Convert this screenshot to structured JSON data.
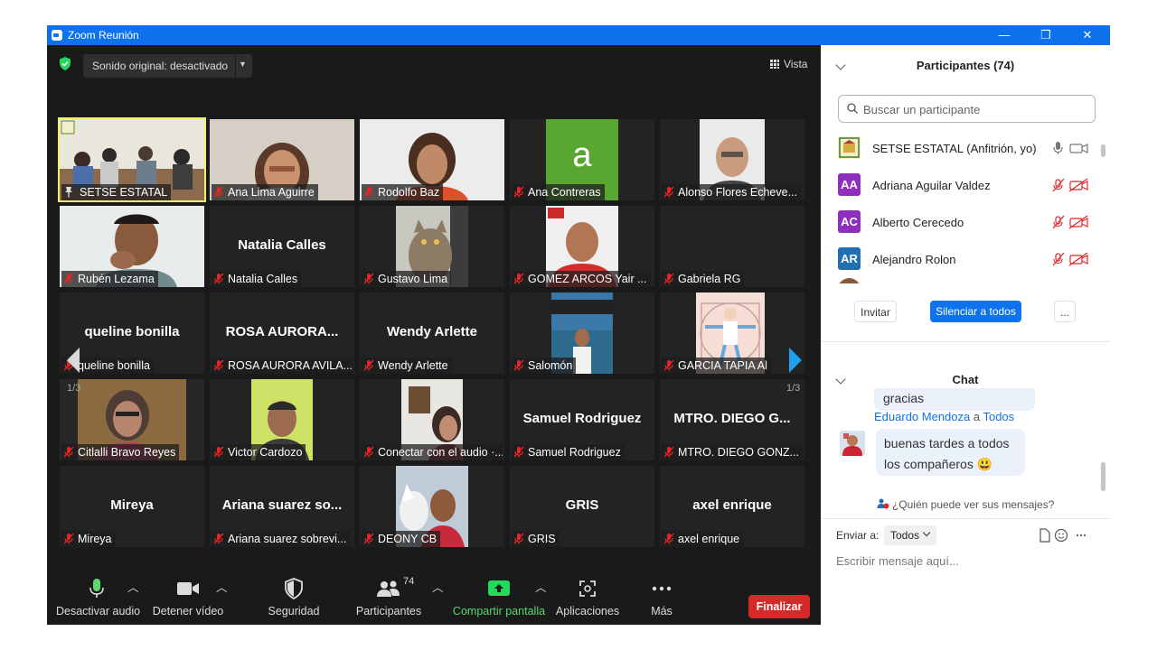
{
  "window": {
    "title": "Zoom Reunión",
    "minimize": "—",
    "restore": "❐",
    "close": "✕"
  },
  "meeting_top": {
    "sonido_label": "Sonido original: desactivado",
    "vista_label": "Vista"
  },
  "pages": {
    "left": "1/3",
    "right": "1/3"
  },
  "tiles": [
    {
      "name": "SETSE ESTATAL",
      "big": "",
      "active": true,
      "pinned": true,
      "video": "room"
    },
    {
      "name": "Ana Lima Aguirre",
      "big": "",
      "video": "woman1"
    },
    {
      "name": "Rodolfo Baz",
      "big": "",
      "video": "woman2"
    },
    {
      "name": "Ana Contreras",
      "big": "",
      "video": "letter"
    },
    {
      "name": "Alonso Flores Echeve...",
      "big": "",
      "video": "man1"
    },
    {
      "name": "Rubén Lezama",
      "big": "",
      "video": "man2"
    },
    {
      "name": "Natalia Calles",
      "big": "Natalia Calles",
      "video": ""
    },
    {
      "name": "Gustavo Lima",
      "big": "",
      "video": "cat"
    },
    {
      "name": "GOMEZ ARCOS Yair ...",
      "big": "",
      "video": "man3"
    },
    {
      "name": "Gabriela RG",
      "big": "",
      "video": ""
    },
    {
      "name": "queline bonilla",
      "big": "queline bonilla",
      "video": ""
    },
    {
      "name": "ROSA AURORA AVILA...",
      "big": "ROSA  AURORA...",
      "video": ""
    },
    {
      "name": "Wendy  Arlette",
      "big": "Wendy  Arlette",
      "video": ""
    },
    {
      "name": "Salomón",
      "big": "",
      "video": "man4"
    },
    {
      "name": "GARCIA TAPIA Al",
      "big": "",
      "video": "drawing"
    },
    {
      "name": "Citlalli Bravo Reyes",
      "big": "",
      "video": "woman3"
    },
    {
      "name": "Victor Cardozo",
      "big": "",
      "video": "man5"
    },
    {
      "name": "Conectar con el audio ·...",
      "big": "",
      "video": "woman4"
    },
    {
      "name": "Samuel Rodriguez",
      "big": "Samuel Rodriguez",
      "video": ""
    },
    {
      "name": "MTRO. DIEGO GONZ...",
      "big": "MTRO. DIEGO G...",
      "video": ""
    },
    {
      "name": "Mireya",
      "big": "Mireya",
      "video": ""
    },
    {
      "name": "Ariana suarez sobrevi...",
      "big": "Ariana suarez so...",
      "video": ""
    },
    {
      "name": "DEONY CB",
      "big": "",
      "video": "man6"
    },
    {
      "name": "GRIS",
      "big": "GRIS",
      "video": ""
    },
    {
      "name": "axel enrique",
      "big": "axel enrique",
      "video": ""
    }
  ],
  "toolbar": {
    "audio": "Desactivar audio",
    "video": "Detener vídeo",
    "security": "Seguridad",
    "participants": "Participantes",
    "participants_count": "74",
    "share": "Compartir pantalla",
    "apps": "Aplicaciones",
    "more": "Más",
    "end": "Finalizar"
  },
  "participants_panel": {
    "title": "Participantes (74)",
    "search_placeholder": "Buscar un participante",
    "rows": [
      {
        "initials": "",
        "name": "SETSE ESTATAL (Anfitrión, yo)",
        "color": "#ffffff"
      },
      {
        "initials": "AA",
        "name": "Adriana Aguilar Valdez",
        "color": "#8e2fc0"
      },
      {
        "initials": "AC",
        "name": "Alberto Cerecedo",
        "color": "#8e2fc0"
      },
      {
        "initials": "AR",
        "name": "Alejandro Rolon",
        "color": "#1f6fb2"
      }
    ],
    "invite": "Invitar",
    "mute_all": "Silenciar a todos",
    "more": "..."
  },
  "chat": {
    "title": "Chat",
    "prev_msg": "gracias",
    "sender": "Eduardo Mendoza",
    "sender_sep": " a ",
    "recipient": "Todos",
    "message_line1": "buenas tardes a todos",
    "message_line2": "los compañeros 😃",
    "who_can": "¿Quién puede ver sus mensajes?",
    "send_to_label": "Enviar a:",
    "send_to_value": "Todos",
    "input_placeholder": "Escribir mensaje aquí..."
  },
  "colors": {
    "titlebar": "#0e72ed",
    "end": "#d42a2a",
    "share": "#59d86b",
    "active": "#f4f06a"
  }
}
